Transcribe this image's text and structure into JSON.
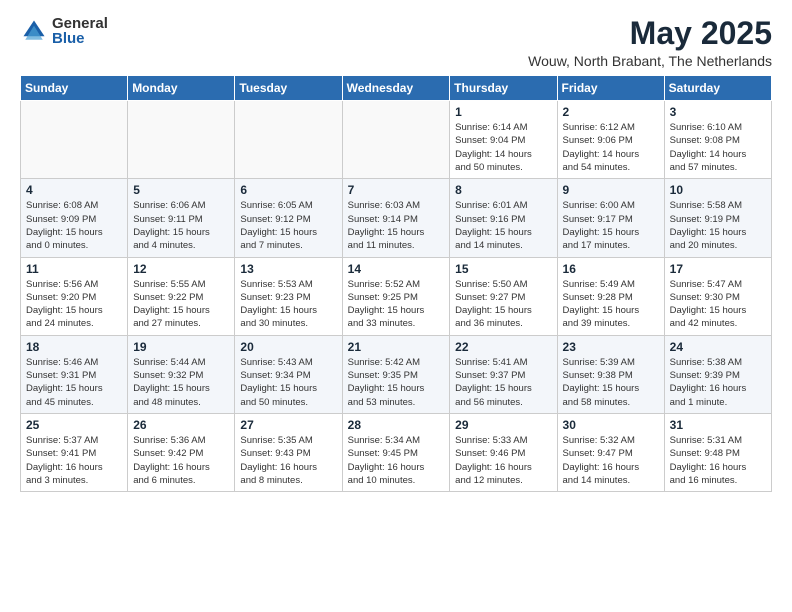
{
  "logo": {
    "general": "General",
    "blue": "Blue"
  },
  "title": "May 2025",
  "subtitle": "Wouw, North Brabant, The Netherlands",
  "weekdays": [
    "Sunday",
    "Monday",
    "Tuesday",
    "Wednesday",
    "Thursday",
    "Friday",
    "Saturday"
  ],
  "weeks": [
    [
      {
        "day": "",
        "info": ""
      },
      {
        "day": "",
        "info": ""
      },
      {
        "day": "",
        "info": ""
      },
      {
        "day": "",
        "info": ""
      },
      {
        "day": "1",
        "info": "Sunrise: 6:14 AM\nSunset: 9:04 PM\nDaylight: 14 hours\nand 50 minutes."
      },
      {
        "day": "2",
        "info": "Sunrise: 6:12 AM\nSunset: 9:06 PM\nDaylight: 14 hours\nand 54 minutes."
      },
      {
        "day": "3",
        "info": "Sunrise: 6:10 AM\nSunset: 9:08 PM\nDaylight: 14 hours\nand 57 minutes."
      }
    ],
    [
      {
        "day": "4",
        "info": "Sunrise: 6:08 AM\nSunset: 9:09 PM\nDaylight: 15 hours\nand 0 minutes."
      },
      {
        "day": "5",
        "info": "Sunrise: 6:06 AM\nSunset: 9:11 PM\nDaylight: 15 hours\nand 4 minutes."
      },
      {
        "day": "6",
        "info": "Sunrise: 6:05 AM\nSunset: 9:12 PM\nDaylight: 15 hours\nand 7 minutes."
      },
      {
        "day": "7",
        "info": "Sunrise: 6:03 AM\nSunset: 9:14 PM\nDaylight: 15 hours\nand 11 minutes."
      },
      {
        "day": "8",
        "info": "Sunrise: 6:01 AM\nSunset: 9:16 PM\nDaylight: 15 hours\nand 14 minutes."
      },
      {
        "day": "9",
        "info": "Sunrise: 6:00 AM\nSunset: 9:17 PM\nDaylight: 15 hours\nand 17 minutes."
      },
      {
        "day": "10",
        "info": "Sunrise: 5:58 AM\nSunset: 9:19 PM\nDaylight: 15 hours\nand 20 minutes."
      }
    ],
    [
      {
        "day": "11",
        "info": "Sunrise: 5:56 AM\nSunset: 9:20 PM\nDaylight: 15 hours\nand 24 minutes."
      },
      {
        "day": "12",
        "info": "Sunrise: 5:55 AM\nSunset: 9:22 PM\nDaylight: 15 hours\nand 27 minutes."
      },
      {
        "day": "13",
        "info": "Sunrise: 5:53 AM\nSunset: 9:23 PM\nDaylight: 15 hours\nand 30 minutes."
      },
      {
        "day": "14",
        "info": "Sunrise: 5:52 AM\nSunset: 9:25 PM\nDaylight: 15 hours\nand 33 minutes."
      },
      {
        "day": "15",
        "info": "Sunrise: 5:50 AM\nSunset: 9:27 PM\nDaylight: 15 hours\nand 36 minutes."
      },
      {
        "day": "16",
        "info": "Sunrise: 5:49 AM\nSunset: 9:28 PM\nDaylight: 15 hours\nand 39 minutes."
      },
      {
        "day": "17",
        "info": "Sunrise: 5:47 AM\nSunset: 9:30 PM\nDaylight: 15 hours\nand 42 minutes."
      }
    ],
    [
      {
        "day": "18",
        "info": "Sunrise: 5:46 AM\nSunset: 9:31 PM\nDaylight: 15 hours\nand 45 minutes."
      },
      {
        "day": "19",
        "info": "Sunrise: 5:44 AM\nSunset: 9:32 PM\nDaylight: 15 hours\nand 48 minutes."
      },
      {
        "day": "20",
        "info": "Sunrise: 5:43 AM\nSunset: 9:34 PM\nDaylight: 15 hours\nand 50 minutes."
      },
      {
        "day": "21",
        "info": "Sunrise: 5:42 AM\nSunset: 9:35 PM\nDaylight: 15 hours\nand 53 minutes."
      },
      {
        "day": "22",
        "info": "Sunrise: 5:41 AM\nSunset: 9:37 PM\nDaylight: 15 hours\nand 56 minutes."
      },
      {
        "day": "23",
        "info": "Sunrise: 5:39 AM\nSunset: 9:38 PM\nDaylight: 15 hours\nand 58 minutes."
      },
      {
        "day": "24",
        "info": "Sunrise: 5:38 AM\nSunset: 9:39 PM\nDaylight: 16 hours\nand 1 minute."
      }
    ],
    [
      {
        "day": "25",
        "info": "Sunrise: 5:37 AM\nSunset: 9:41 PM\nDaylight: 16 hours\nand 3 minutes."
      },
      {
        "day": "26",
        "info": "Sunrise: 5:36 AM\nSunset: 9:42 PM\nDaylight: 16 hours\nand 6 minutes."
      },
      {
        "day": "27",
        "info": "Sunrise: 5:35 AM\nSunset: 9:43 PM\nDaylight: 16 hours\nand 8 minutes."
      },
      {
        "day": "28",
        "info": "Sunrise: 5:34 AM\nSunset: 9:45 PM\nDaylight: 16 hours\nand 10 minutes."
      },
      {
        "day": "29",
        "info": "Sunrise: 5:33 AM\nSunset: 9:46 PM\nDaylight: 16 hours\nand 12 minutes."
      },
      {
        "day": "30",
        "info": "Sunrise: 5:32 AM\nSunset: 9:47 PM\nDaylight: 16 hours\nand 14 minutes."
      },
      {
        "day": "31",
        "info": "Sunrise: 5:31 AM\nSunset: 9:48 PM\nDaylight: 16 hours\nand 16 minutes."
      }
    ]
  ]
}
